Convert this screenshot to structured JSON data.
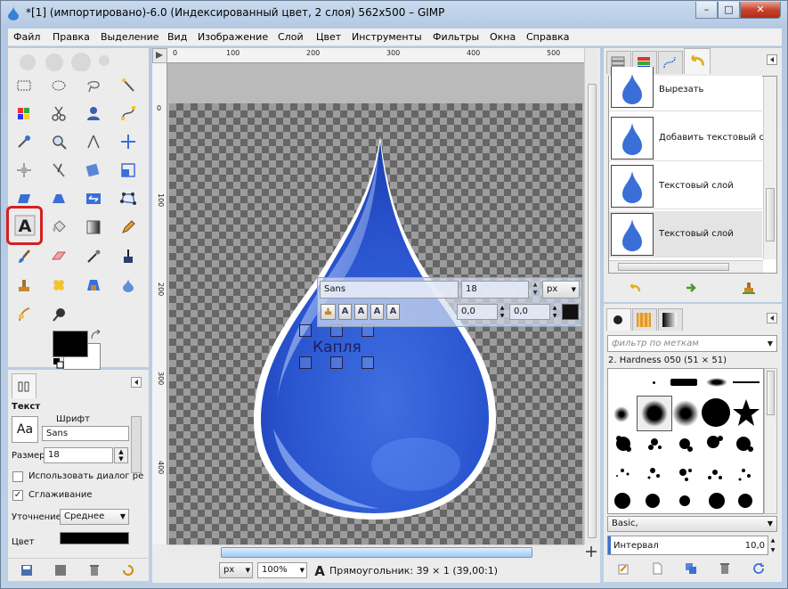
{
  "window": {
    "title": "*[1] (импортировано)-6.0 (Индексированный цвет, 2 слоя) 562x500 – GIMP",
    "controls": {
      "minimize": "–",
      "maximize": "□",
      "close": "✕"
    }
  },
  "menubar": {
    "items": [
      "Файл",
      "Правка",
      "Выделение",
      "Вид",
      "Изображение",
      "Слой",
      "Цвет",
      "Инструменты",
      "Фильтры",
      "Окна",
      "Справка"
    ]
  },
  "toolbox": {
    "tools": [
      "rect-select",
      "ellipse-select",
      "free-select",
      "fuzzy-select",
      "color-select",
      "scissors-select",
      "foreground-select",
      "paths",
      "color-picker",
      "zoom",
      "measure",
      "move",
      "align",
      "crop",
      "rotate",
      "scale",
      "shear",
      "perspective",
      "flip",
      "cage",
      "text",
      "bucket-fill",
      "blend",
      "pencil",
      "paintbrush",
      "eraser",
      "airbrush",
      "ink",
      "clone",
      "heal",
      "perspective-clone",
      "smudge",
      "blur",
      "dodge-burn"
    ],
    "fg_color": "#000000",
    "bg_color": "#ffffff"
  },
  "tool_options": {
    "section_title": "Текст",
    "font_label": "Шрифт",
    "font_preview": "Aa",
    "font_value": "Sans",
    "size_label": "Размер:",
    "size_value": "18",
    "use_dialog_label": "Использовать диалог ре",
    "use_dialog_checked": false,
    "antialias_label": "Сглаживание",
    "antialias_checked": true,
    "hinting_label": "Уточнение:",
    "hinting_value": "Среднее",
    "color_label": "Цвет"
  },
  "rulers": {
    "h_labels": [
      "0",
      "100",
      "200",
      "300",
      "400",
      "500"
    ],
    "v_labels": [
      "0",
      "100",
      "200",
      "300",
      "400"
    ]
  },
  "canvas": {
    "text_layer": "Капля",
    "text_toolbar": {
      "font": "Sans",
      "size": "18",
      "unit": "px",
      "baseline": "0,0",
      "kerning": "0,0",
      "style_buttons": [
        "A",
        "A",
        "A",
        "A",
        "A"
      ]
    }
  },
  "statusbar": {
    "unit": "px",
    "zoom": "100%",
    "message": "Прямоугольник: 39 × 1  (39,00:1)"
  },
  "history": {
    "items": [
      {
        "label": "Вырезать",
        "selected": false
      },
      {
        "label": "Добавить текстовый сло",
        "selected": false
      },
      {
        "label": "Текстовый слой",
        "selected": false
      },
      {
        "label": "Текстовый слой",
        "selected": true
      }
    ]
  },
  "brushes": {
    "filter_placeholder": "фильтр по меткам",
    "current_brush": "2. Hardness 050 (51 × 51)",
    "preset": "Basic,",
    "spacing_label": "Интервал",
    "spacing_value": "10,0"
  },
  "colors": {
    "accent": "#3a6fd8",
    "text_tool_highlight": "#d42020",
    "selection_bg": "#cfd8ea"
  }
}
